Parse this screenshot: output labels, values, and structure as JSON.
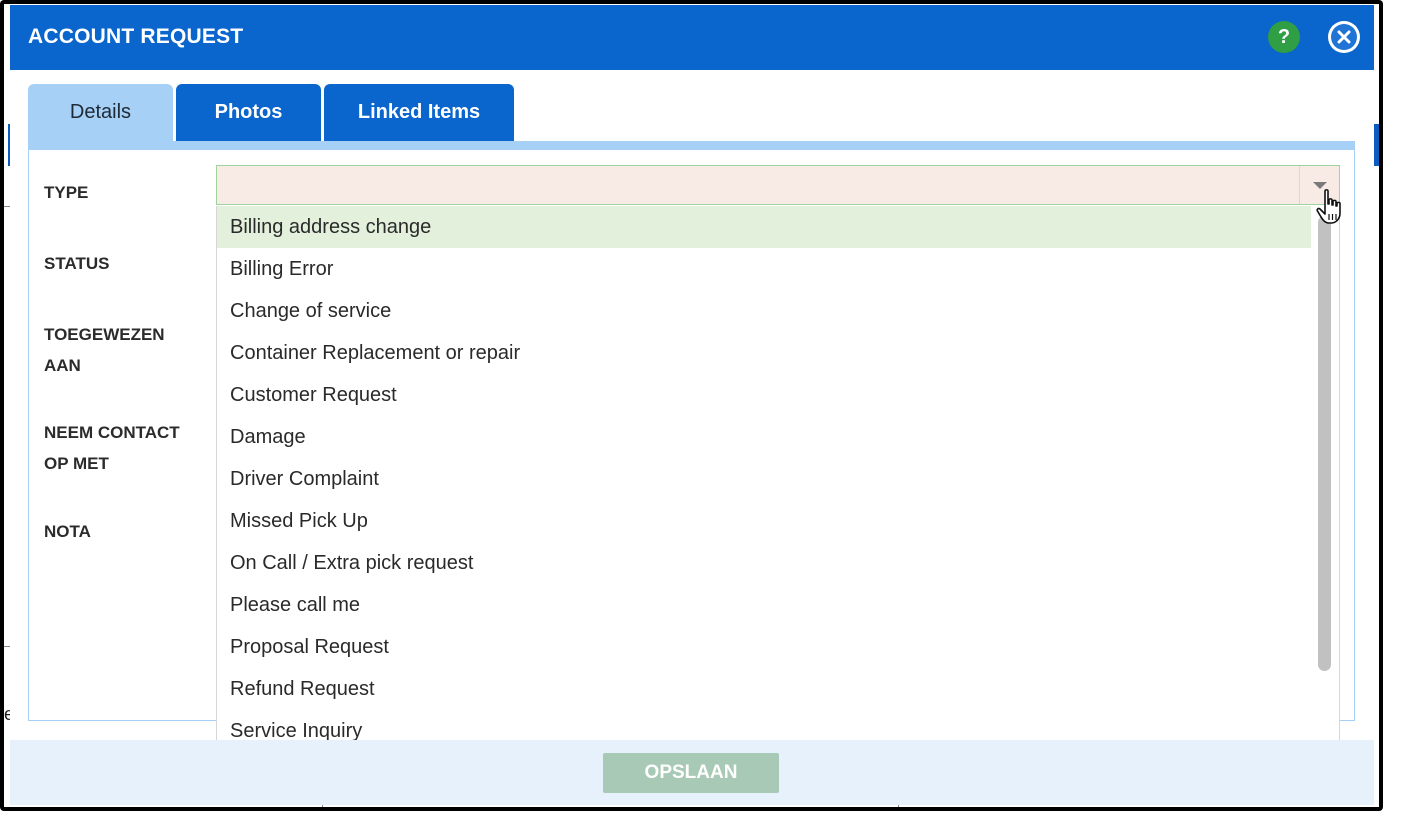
{
  "header": {
    "title": "ACCOUNT REQUEST",
    "help_label": "?"
  },
  "tabs": [
    {
      "label": "Details",
      "active": true
    },
    {
      "label": "Photos",
      "active": false
    },
    {
      "label": "Linked Items",
      "active": false
    }
  ],
  "form": {
    "type_label": "TYPE",
    "type_value": "",
    "status_label": "STATUS",
    "assigned_label_line1": "TOEGEWEZEN",
    "assigned_label_line2": "AAN",
    "contact_label_line1": "NEEM CONTACT",
    "contact_label_line2": "OP MET",
    "note_label": "NOTA"
  },
  "dropdown": {
    "highlighted_index": 0,
    "options": [
      "Billing address change",
      "Billing Error",
      "Change of service",
      "Container Replacement or repair",
      "Customer Request",
      "Damage",
      "Driver Complaint",
      "Missed Pick Up",
      "On Call / Extra pick request",
      "Please call me",
      "Proposal Request",
      "Refund Request",
      "Service Inquiry"
    ]
  },
  "footer": {
    "save_label": "OPSLAAN"
  },
  "background": {
    "fragment_text": "e"
  },
  "colors": {
    "header_bg": "#0a65cc",
    "active_tab_bg": "#a7d0f6",
    "highlight_option_bg": "#e3f0dc",
    "save_button_bg": "#a8c9b6",
    "help_button_bg": "#2f9e44"
  }
}
